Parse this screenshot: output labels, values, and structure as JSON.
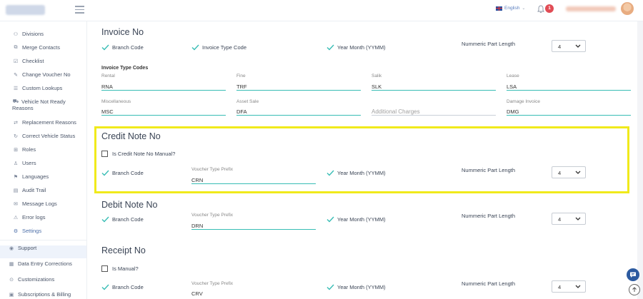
{
  "header": {
    "language": "English",
    "notification_count": "1"
  },
  "sidebar": {
    "items": [
      {
        "label": "Divisions",
        "icon": "division-icon"
      },
      {
        "label": "Merge Contacts",
        "icon": "merge-icon"
      },
      {
        "label": "Checklist",
        "icon": "checklist-icon"
      },
      {
        "label": "Change Voucher No",
        "icon": "edit-icon"
      },
      {
        "label": "Custom Lookups",
        "icon": "list-icon"
      },
      {
        "label": "Vehicle Not Ready",
        "label2": "Reasons",
        "icon": "car-icon"
      },
      {
        "label": "Replacement Reasons",
        "icon": "swap-icon"
      },
      {
        "label": "Correct Vehicle Status",
        "icon": "refresh-icon"
      },
      {
        "label": "Roles",
        "icon": "roles-icon"
      },
      {
        "label": "Users",
        "icon": "user-icon"
      },
      {
        "label": "Languages",
        "icon": "language-icon"
      },
      {
        "label": "Audit Trail",
        "icon": "audit-icon"
      },
      {
        "label": "Message Logs",
        "icon": "message-icon"
      },
      {
        "label": "Error logs",
        "icon": "error-icon"
      },
      {
        "label": "Settings",
        "icon": "gear-icon"
      }
    ],
    "top_items": [
      {
        "label": "Support",
        "icon": "support-icon"
      },
      {
        "label": "Data Entry Corrections",
        "icon": "data-entry-icon"
      },
      {
        "label": "Customizations",
        "icon": "customize-icon"
      },
      {
        "label": "Subscriptions & Billing",
        "icon": "billing-icon"
      }
    ]
  },
  "invoice": {
    "title": "Invoice No",
    "branch_code": "Branch Code",
    "invoice_type_code": "Invoice Type Code",
    "year_month": "Year Month (YYMM)",
    "numeric_label": "Nummeric Part Length",
    "numeric_value": "4",
    "codes_heading": "Invoice Type Codes",
    "codes": [
      {
        "label": "Rental",
        "value": "RNA"
      },
      {
        "label": "Fine",
        "value": "TRF"
      },
      {
        "label": "Salik",
        "value": "SLK"
      },
      {
        "label": "Lease",
        "value": "LSA"
      },
      {
        "label": "Miscellaneous",
        "value": "MSC"
      },
      {
        "label": "Asset Sale",
        "value": "DFA"
      },
      {
        "label": "",
        "placeholder": "Additional Charges"
      },
      {
        "label": "Damage Invoice",
        "value": "DMG"
      }
    ]
  },
  "credit": {
    "title": "Credit Note No",
    "manual_label": "Is Credit Note No Manual?",
    "branch_code": "Branch Code",
    "prefix_label": "Voucher Type Prefix",
    "prefix_value": "CRN",
    "year_month": "Year Month (YYMM)",
    "numeric_label": "Nummeric Part Length",
    "numeric_value": "4"
  },
  "debit": {
    "title": "Debit Note No",
    "branch_code": "Branch Code",
    "prefix_label": "Voucher Type Prefix",
    "prefix_value": "DRN",
    "year_month": "Year Month (YYMM)",
    "numeric_label": "Nummeric Part Length",
    "numeric_value": "4"
  },
  "receipt": {
    "title": "Receipt No",
    "manual_label": "Is Manual?",
    "branch_code": "Branch Code",
    "prefix_label": "Voucher Type Prefix",
    "prefix_value": "CRV",
    "year_month": "Year Month (YYMM)",
    "numeric_label": "Nummeric Part Length",
    "numeric_value": "4"
  },
  "colors": {
    "accent": "#38bdb5",
    "highlight": "#f0ea1b",
    "badge": "#e14c55",
    "chat": "#2c5aa0"
  }
}
